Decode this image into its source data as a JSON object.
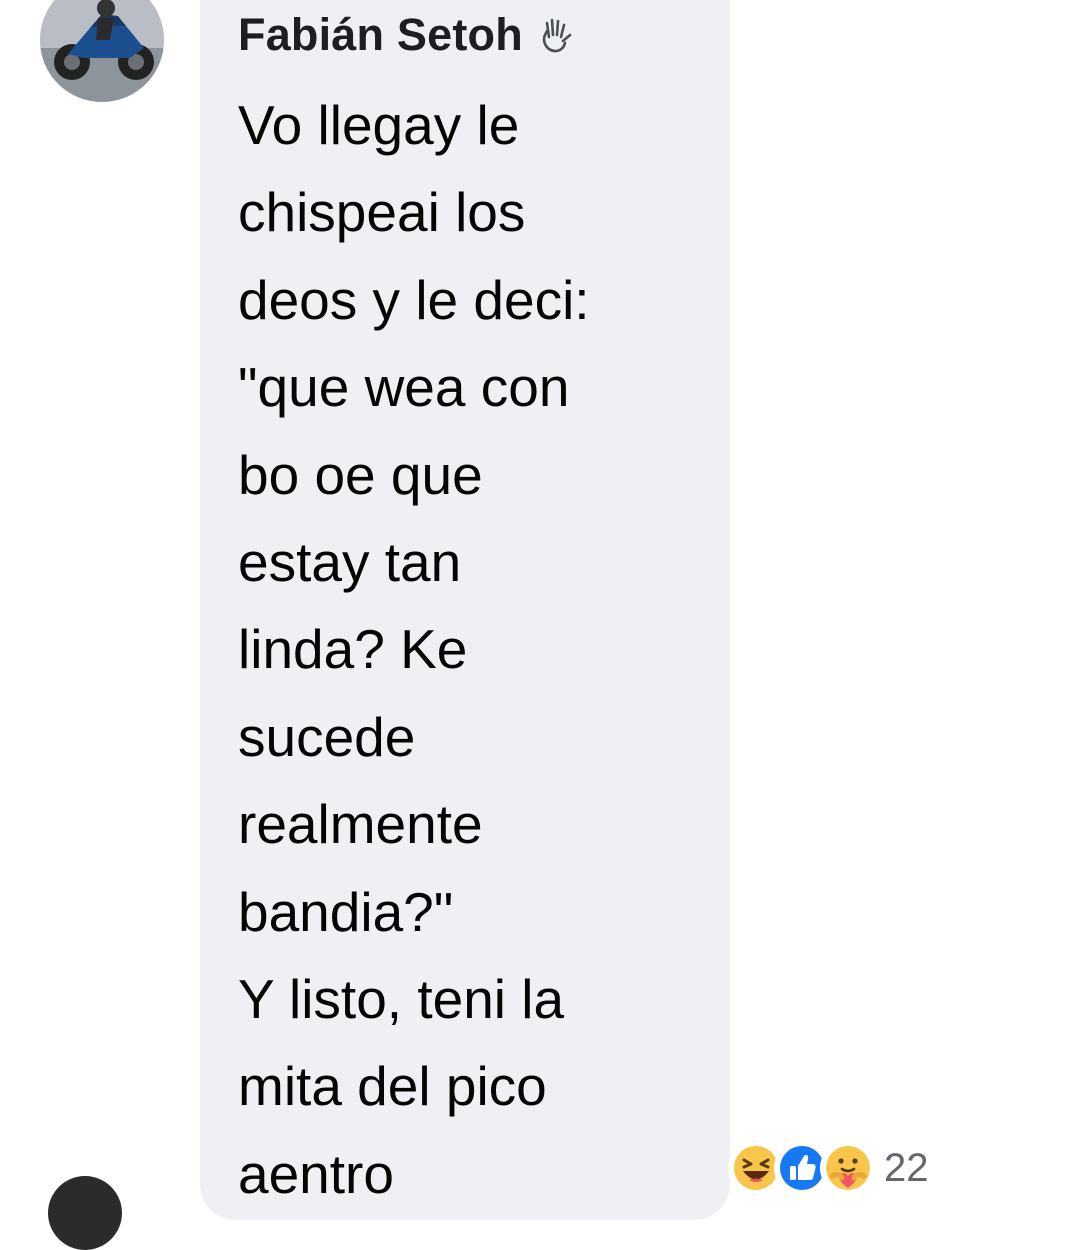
{
  "comment": {
    "author": "Fabián Setoh",
    "author_badge_icon": "waving-hand-icon",
    "avatar_icon": "motorcycle-avatar-icon",
    "lines": [
      "Vo llegay le",
      "chispeai los",
      "deos y le deci:",
      "\"que wea con",
      "bo oe que",
      "estay tan",
      "linda? Ke",
      "sucede",
      "realmente",
      "bandia?\"",
      "Y listo, teni la",
      "mita del pico",
      "aentro"
    ],
    "reactions": {
      "icons": [
        "haha-icon",
        "like-icon",
        "care-icon"
      ],
      "count": "22"
    }
  },
  "colors": {
    "bubble_background": "#eff0f4",
    "like_blue": "#1877f2",
    "emoji_yellow": "#f7c64b",
    "count_gray": "#606770"
  }
}
